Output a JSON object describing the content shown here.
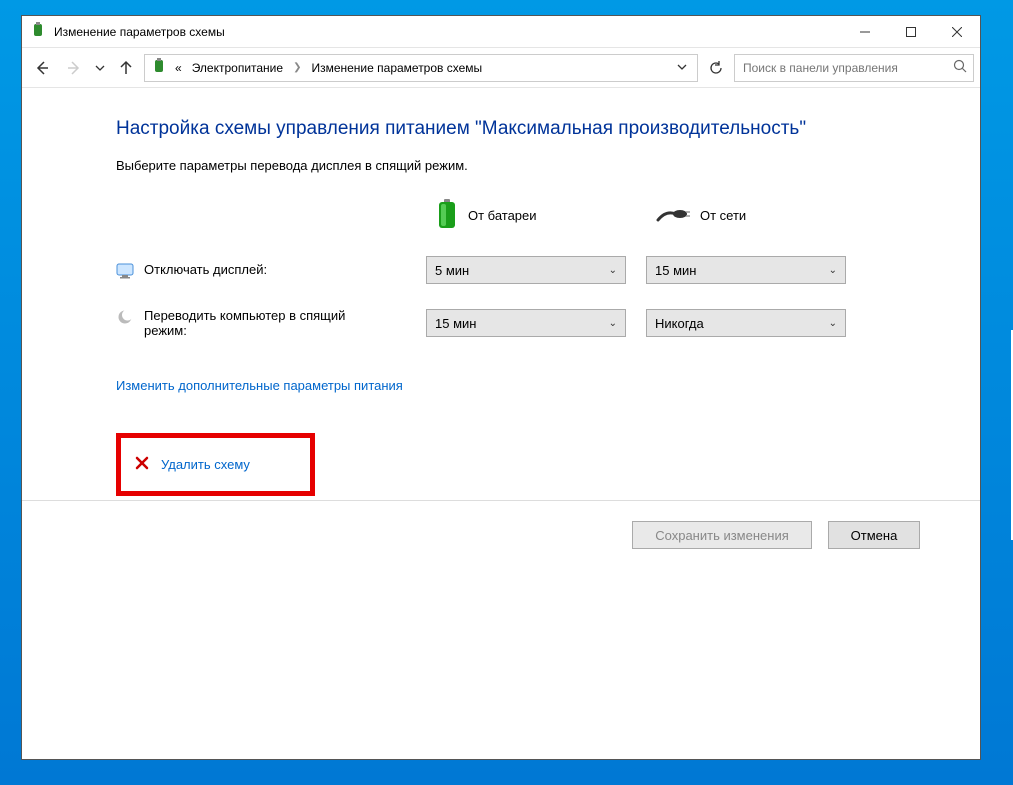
{
  "titlebar": {
    "title": "Изменение параметров схемы"
  },
  "breadcrumb": {
    "prefix": "«",
    "seg1": "Электропитание",
    "seg2": "Изменение параметров схемы"
  },
  "search": {
    "placeholder": "Поиск в панели управления"
  },
  "page": {
    "title": "Настройка схемы управления питанием \"Максимальная производительность\"",
    "subtitle": "Выберите параметры перевода дисплея в спящий режим."
  },
  "columns": {
    "battery": "От батареи",
    "plugged": "От сети"
  },
  "rows": {
    "display_off": "Отключать дисплей:",
    "sleep": "Переводить компьютер в спящий режим:"
  },
  "values": {
    "display_off_battery": "5 мин",
    "display_off_plugged": "15 мин",
    "sleep_battery": "15 мин",
    "sleep_plugged": "Никогда"
  },
  "links": {
    "advanced": "Изменить дополнительные параметры питания",
    "delete": "Удалить схему"
  },
  "buttons": {
    "save": "Сохранить изменения",
    "cancel": "Отмена"
  }
}
